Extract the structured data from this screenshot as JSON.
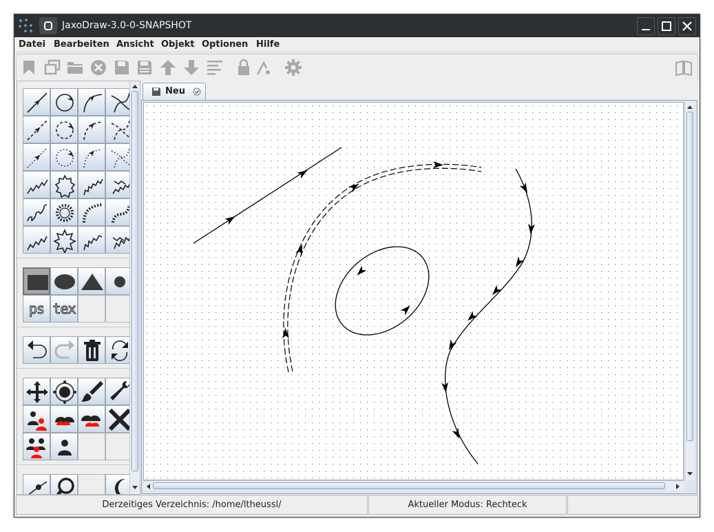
{
  "window": {
    "title": "JaxoDraw-3.0-0-SNAPSHOT"
  },
  "menu": [
    "Datei",
    "Bearbeiten",
    "Ansicht",
    "Objekt",
    "Optionen",
    "Hilfe"
  ],
  "toolbar": {
    "buttons": [
      "new-document-icon",
      "new-window-icon",
      "open-folder-icon",
      "close-icon",
      "save-icon",
      "save-as-icon",
      "move-up-icon",
      "move-down-icon",
      "align-icon",
      "lock-icon",
      "grid-snap-icon",
      "settings-icon"
    ],
    "help_icon": "book-icon"
  },
  "tabs": [
    {
      "label": "Neu",
      "active": true
    }
  ],
  "status": {
    "directory": "Derzeitiges Verzeichnis: /home/ltheussl/",
    "mode": "Aktueller Modus: Rechteck",
    "extra": ""
  },
  "palette_text": {
    "ps": "ps",
    "tex": "tex"
  },
  "colors": {
    "titlebar": "#2c2f33",
    "accent": "#c7d6ea",
    "red": "#ff1100"
  }
}
